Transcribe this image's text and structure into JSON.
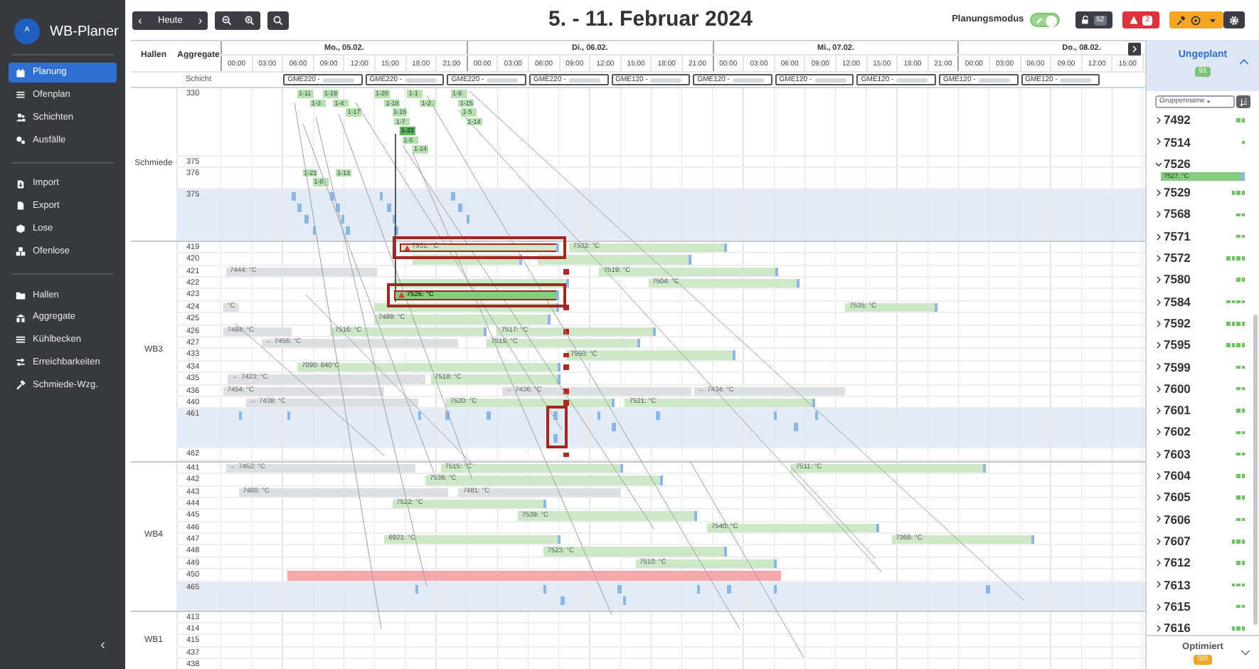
{
  "sidebar": {
    "logo_letter": "A",
    "app_name": "WB-Planer",
    "collapse": "‹",
    "groups": [
      [
        {
          "label": "Planung",
          "selected": true
        },
        {
          "label": "Ofenplan",
          "selected": false
        },
        {
          "label": "Schichten",
          "selected": false
        },
        {
          "label": "Ausfälle",
          "selected": false
        }
      ],
      [
        {
          "label": "Import",
          "selected": false
        },
        {
          "label": "Export",
          "selected": false
        },
        {
          "label": "Lose",
          "selected": false
        },
        {
          "label": "Ofenlose",
          "selected": false
        }
      ],
      [
        {
          "label": "Hallen",
          "selected": false
        },
        {
          "label": "Aggregate",
          "selected": false
        },
        {
          "label": "Kühlbecken",
          "selected": false
        },
        {
          "label": "Erreichbarkeiten",
          "selected": false
        },
        {
          "label": "Schmiede-Wzg.",
          "selected": false
        }
      ]
    ]
  },
  "toolbar": {
    "prev": "‹",
    "today": "Heute",
    "next": "›",
    "title": "5. - 11. Februar 2024",
    "mode_label": "Planungsmodus",
    "mode_on": true,
    "lock_badge": "52",
    "alert_badge": "2"
  },
  "gantt": {
    "columns": [
      "Hallen",
      "Aggregate"
    ],
    "days": [
      {
        "label": "Mo., 05.02.",
        "hours": [
          "00:00",
          "03:00",
          "06:00",
          "09:00",
          "12:00",
          "15:00",
          "18:00",
          "21:00"
        ]
      },
      {
        "label": "Di., 06.02.",
        "hours": [
          "00:00",
          "03:00",
          "06:00",
          "09:00",
          "12:00",
          "15:00",
          "18:00",
          "21:00"
        ]
      },
      {
        "label": "Mi., 07.02.",
        "hours": [
          "00:00",
          "03:00",
          "06:00",
          "09:00",
          "12:00",
          "15:00",
          "18:00",
          "21:00"
        ]
      },
      {
        "label": "Do., 08.02.",
        "hours": [
          "00:00",
          "03:00",
          "06:00",
          "09:00",
          "12:00",
          "15:00"
        ]
      }
    ],
    "shift_row": {
      "label": "Schicht",
      "shifts": [
        "GME220 -",
        "GME220 -",
        "GME220 -",
        "GME220 -",
        "GME120 -",
        "GME120 -",
        "GME120 -",
        "GME120 -",
        "GME120 -",
        "GME120 -"
      ]
    },
    "halls": [
      {
        "name": "Schmiede",
        "rows": [
          {
            "unit": "330",
            "kind": "unit",
            "conflict": false,
            "highlighted": false,
            "cascades": [
              [
                {
                  "label": "1-11",
                  "selected": false
                },
                {
                  "label": "1-3",
                  "selected": false
                }
              ],
              [
                {
                  "label": "1-19",
                  "selected": false
                },
                {
                  "label": "1-4",
                  "selected": false
                },
                {
                  "label": "1-17",
                  "selected": false
                }
              ],
              [
                {
                  "label": "1-20",
                  "selected": false
                },
                {
                  "label": "1-18",
                  "selected": false
                },
                {
                  "label": "1-16",
                  "selected": false
                },
                {
                  "label": "1-7",
                  "selected": false
                },
                {
                  "label": "1-22",
                  "selected": true
                },
                {
                  "label": "1-5",
                  "selected": false
                },
                {
                  "label": "1-24",
                  "selected": false
                }
              ],
              [
                {
                  "label": "1-1",
                  "selected": false
                },
                {
                  "label": "1-2",
                  "selected": false
                }
              ],
              [
                {
                  "label": "1-9",
                  "selected": false
                },
                {
                  "label": "1-15",
                  "selected": false
                },
                {
                  "label": "1-5",
                  "selected": false
                },
                {
                  "label": "1-14",
                  "selected": false
                }
              ]
            ]
          },
          {
            "unit": "375",
            "kind": "unit",
            "conflict": false,
            "highlighted": false
          },
          {
            "unit": "376",
            "kind": "unit",
            "conflict": false,
            "highlighted": false,
            "cascades": [
              [
                {
                  "label": "1-21",
                  "selected": false
                },
                {
                  "label": "1-8",
                  "selected": false
                }
              ],
              [
                {
                  "label": "1-13",
                  "selected": false
                }
              ]
            ]
          },
          {
            "unit": "375",
            "kind": "capacity",
            "conflict": false,
            "highlighted": false
          }
        ]
      },
      {
        "name": "WB3",
        "rows": [
          {
            "unit": "419",
            "kind": "unit",
            "conflict": false,
            "highlighted": false,
            "bars": [
              {
                "kind": "planned",
                "label": "7531: °C",
                "warning": true,
                "highlighted": true
              },
              {
                "kind": "planned",
                "label": "7532: °C",
                "warning": false,
                "highlighted": false
              }
            ]
          },
          {
            "unit": "420",
            "kind": "unit",
            "conflict": false,
            "highlighted": false,
            "bars": [
              {
                "kind": "planned",
                "warning": false,
                "highlighted": false
              },
              {
                "kind": "planned",
                "warning": false,
                "highlighted": false
              }
            ]
          },
          {
            "unit": "421",
            "kind": "unit",
            "conflict": true,
            "highlighted": false,
            "bars": [
              {
                "kind": "external",
                "label": "7444: °C",
                "warning": false,
                "highlighted": false
              },
              {
                "kind": "planned",
                "label": "7519: °C",
                "warning": false,
                "highlighted": false
              }
            ]
          },
          {
            "unit": "422",
            "kind": "unit",
            "conflict": false,
            "highlighted": false,
            "bars": [
              {
                "kind": "planned",
                "warning": false,
                "highlighted": false
              },
              {
                "kind": "planned",
                "label": "7504: °C",
                "warning": false,
                "highlighted": false
              }
            ]
          },
          {
            "unit": "423",
            "kind": "unit",
            "conflict": false,
            "highlighted": false,
            "bars": [
              {
                "kind": "active",
                "label": "7526: °C",
                "warning": true,
                "highlighted": true
              }
            ]
          },
          {
            "unit": "424",
            "kind": "unit",
            "conflict": true,
            "highlighted": false,
            "bars": [
              {
                "kind": "external",
                "label": "°C",
                "warning": false,
                "highlighted": false
              },
              {
                "kind": "planned",
                "warning": false,
                "highlighted": false
              },
              {
                "kind": "planned",
                "label": "7535: °C",
                "warning": false,
                "highlighted": false
              }
            ]
          },
          {
            "unit": "425",
            "kind": "unit",
            "conflict": false,
            "highlighted": false,
            "bars": [
              {
                "kind": "planned",
                "label": "7489: °C",
                "warning": false,
                "highlighted": false
              }
            ]
          },
          {
            "unit": "426",
            "kind": "unit",
            "conflict": true,
            "highlighted": false,
            "bars": [
              {
                "kind": "external",
                "label": "7484: °C",
                "warning": false,
                "highlighted": false
              },
              {
                "kind": "planned",
                "label": "7516: °C",
                "warning": false,
                "highlighted": false
              },
              {
                "kind": "planned",
                "label": "7517: °C",
                "warning": false,
                "highlighted": false
              }
            ]
          },
          {
            "unit": "427",
            "kind": "unit",
            "conflict": false,
            "highlighted": false,
            "bars": [
              {
                "kind": "external",
                "label": "← 7456: °C",
                "warning": false,
                "highlighted": false
              },
              {
                "kind": "planned",
                "label": "7519: °C",
                "warning": false,
                "highlighted": false
              }
            ]
          },
          {
            "unit": "433",
            "kind": "unit",
            "conflict": true,
            "highlighted": false,
            "bars": [
              {
                "kind": "planned",
                "label": "7550: °C",
                "warning": false,
                "highlighted": false
              }
            ]
          },
          {
            "unit": "434",
            "kind": "unit",
            "conflict": true,
            "highlighted": false,
            "bars": [
              {
                "kind": "planned",
                "label": "7090: 840°C",
                "warning": false,
                "highlighted": false
              }
            ]
          },
          {
            "unit": "435",
            "kind": "unit",
            "conflict": false,
            "highlighted": false,
            "bars": [
              {
                "kind": "external",
                "label": "← 7423: °C",
                "warning": false,
                "highlighted": false
              },
              {
                "kind": "planned",
                "label": "7518: °C",
                "warning": false,
                "highlighted": false
              }
            ]
          },
          {
            "unit": "436",
            "kind": "unit",
            "conflict": true,
            "highlighted": false,
            "bars": [
              {
                "kind": "external",
                "label": "7454: °C",
                "warning": false,
                "highlighted": false
              },
              {
                "kind": "external",
                "label": "← 7436: °C",
                "warning": false,
                "highlighted": false
              },
              {
                "kind": "external",
                "label": "← 7434: °C",
                "warning": false,
                "highlighted": false
              }
            ]
          },
          {
            "unit": "440",
            "kind": "unit",
            "conflict": true,
            "highlighted": false,
            "bars": [
              {
                "kind": "external",
                "label": "← 7438: °C",
                "warning": false,
                "highlighted": false
              },
              {
                "kind": "planned",
                "label": "7520: °C",
                "warning": false,
                "highlighted": false
              },
              {
                "kind": "planned",
                "label": "7521: °C",
                "warning": false,
                "highlighted": false
              }
            ]
          },
          {
            "unit": "461",
            "kind": "capacity",
            "conflict": false,
            "highlighted": true
          },
          {
            "unit": "462",
            "kind": "unit",
            "conflict": true,
            "highlighted": false
          }
        ]
      },
      {
        "name": "WB4",
        "rows": [
          {
            "unit": "441",
            "kind": "unit",
            "conflict": false,
            "highlighted": false,
            "bars": [
              {
                "kind": "external",
                "label": "← 7452: °C",
                "warning": false,
                "highlighted": false
              },
              {
                "kind": "planned",
                "label": "7515: °C",
                "warning": false,
                "highlighted": false
              },
              {
                "kind": "planned",
                "label": "7511: °C",
                "warning": false,
                "highlighted": false
              }
            ]
          },
          {
            "unit": "442",
            "kind": "unit",
            "conflict": false,
            "highlighted": false,
            "bars": [
              {
                "kind": "planned",
                "label": "7536: °C",
                "warning": false,
                "highlighted": false
              }
            ]
          },
          {
            "unit": "443",
            "kind": "unit",
            "conflict": false,
            "highlighted": false,
            "bars": [
              {
                "kind": "external",
                "label": "7480: °C",
                "warning": false,
                "highlighted": false
              },
              {
                "kind": "external",
                "label": "7481: °C",
                "warning": false,
                "highlighted": false
              }
            ]
          },
          {
            "unit": "444",
            "kind": "unit",
            "conflict": false,
            "highlighted": false,
            "bars": [
              {
                "kind": "planned",
                "label": "7522: °C",
                "warning": false,
                "highlighted": false
              }
            ]
          },
          {
            "unit": "445",
            "kind": "unit",
            "conflict": false,
            "highlighted": false,
            "bars": [
              {
                "kind": "planned",
                "label": "7539: °C",
                "warning": false,
                "highlighted": false
              }
            ]
          },
          {
            "unit": "446",
            "kind": "unit",
            "conflict": false,
            "highlighted": false,
            "bars": [
              {
                "kind": "planned",
                "label": "7540: °C",
                "warning": false,
                "highlighted": false
              }
            ]
          },
          {
            "unit": "447",
            "kind": "unit",
            "conflict": false,
            "highlighted": false,
            "bars": [
              {
                "kind": "planned",
                "label": "6921: °C",
                "warning": false,
                "highlighted": false
              },
              {
                "kind": "planned",
                "label": "7368: °C",
                "warning": false,
                "highlighted": false
              }
            ]
          },
          {
            "unit": "448",
            "kind": "unit",
            "conflict": false,
            "highlighted": false,
            "bars": [
              {
                "kind": "planned",
                "label": "7523: °C",
                "warning": false,
                "highlighted": false
              }
            ]
          },
          {
            "unit": "449",
            "kind": "unit",
            "conflict": false,
            "highlighted": false,
            "bars": [
              {
                "kind": "planned",
                "label": "7510: °C",
                "warning": false,
                "highlighted": false
              }
            ]
          },
          {
            "unit": "450",
            "kind": "unit",
            "conflict": false,
            "highlighted": false,
            "bars": [
              {
                "kind": "blocked",
                "warning": false,
                "highlighted": false
              }
            ]
          },
          {
            "unit": "465",
            "kind": "capacity",
            "conflict": false,
            "highlighted": false
          }
        ]
      },
      {
        "name": "WB1",
        "rows": [
          {
            "unit": "413",
            "kind": "unit",
            "conflict": false,
            "highlighted": false
          },
          {
            "unit": "414",
            "kind": "unit",
            "conflict": false,
            "highlighted": false
          },
          {
            "unit": "415",
            "kind": "unit",
            "conflict": false,
            "highlighted": false
          },
          {
            "unit": "437",
            "kind": "unit",
            "conflict": false,
            "highlighted": false
          },
          {
            "unit": "438",
            "kind": "unit",
            "conflict": false,
            "highlighted": false
          }
        ]
      }
    ]
  },
  "unplanned": {
    "title": "Ungeplant",
    "count": "91",
    "filter": "Gruppenname",
    "items": [
      {
        "label": "7492",
        "expanded": false,
        "parts": [
          {
            "kind": "open"
          },
          {
            "kind": "open"
          }
        ]
      },
      {
        "label": "7514",
        "expanded": false,
        "parts": [
          {
            "kind": "open"
          }
        ]
      },
      {
        "label": "7526",
        "expanded": true,
        "children": [
          {
            "label": "7527: °C"
          }
        ]
      },
      {
        "label": "7529",
        "expanded": false,
        "parts": [
          {
            "kind": "open"
          },
          {
            "kind": "open"
          },
          {
            "kind": "open"
          }
        ]
      },
      {
        "label": "7568",
        "expanded": false,
        "parts": [
          {
            "kind": "open"
          },
          {
            "kind": "open"
          }
        ]
      },
      {
        "label": "7571",
        "expanded": false,
        "parts": [
          {
            "kind": "open"
          },
          {
            "kind": "open"
          }
        ]
      },
      {
        "label": "7572",
        "expanded": false,
        "parts": [
          {
            "kind": "open"
          },
          {
            "kind": "open"
          },
          {
            "kind": "open"
          },
          {
            "kind": "open"
          }
        ]
      },
      {
        "label": "7580",
        "expanded": false,
        "parts": [
          {
            "kind": "open"
          },
          {
            "kind": "open"
          }
        ]
      },
      {
        "label": "7584",
        "expanded": false,
        "parts": [
          {
            "kind": "open"
          },
          {
            "kind": "open"
          },
          {
            "kind": "open"
          },
          {
            "kind": "open"
          }
        ]
      },
      {
        "label": "7592",
        "expanded": false,
        "parts": [
          {
            "kind": "open"
          },
          {
            "kind": "open"
          },
          {
            "kind": "open"
          },
          {
            "kind": "open"
          }
        ]
      },
      {
        "label": "7595",
        "expanded": false,
        "parts": [
          {
            "kind": "open"
          },
          {
            "kind": "open"
          },
          {
            "kind": "open"
          },
          {
            "kind": "open"
          }
        ]
      },
      {
        "label": "7599",
        "expanded": false,
        "parts": [
          {
            "kind": "open"
          },
          {
            "kind": "open"
          }
        ]
      },
      {
        "label": "7600",
        "expanded": false,
        "parts": [
          {
            "kind": "open"
          },
          {
            "kind": "open"
          }
        ]
      },
      {
        "label": "7601",
        "expanded": false,
        "parts": [
          {
            "kind": "open"
          },
          {
            "kind": "open"
          }
        ]
      },
      {
        "label": "7602",
        "expanded": false,
        "parts": [
          {
            "kind": "open"
          },
          {
            "kind": "open"
          }
        ]
      },
      {
        "label": "7603",
        "expanded": false,
        "parts": [
          {
            "kind": "open"
          },
          {
            "kind": "open"
          }
        ]
      },
      {
        "label": "7604",
        "expanded": false,
        "parts": [
          {
            "kind": "open"
          },
          {
            "kind": "open"
          }
        ]
      },
      {
        "label": "7605",
        "expanded": false,
        "parts": [
          {
            "kind": "open"
          },
          {
            "kind": "open"
          }
        ]
      },
      {
        "label": "7606",
        "expanded": false,
        "parts": [
          {
            "kind": "open"
          },
          {
            "kind": "open"
          }
        ]
      },
      {
        "label": "7607",
        "expanded": false,
        "parts": [
          {
            "kind": "open"
          },
          {
            "kind": "open"
          },
          {
            "kind": "open"
          }
        ]
      },
      {
        "label": "7612",
        "expanded": false,
        "parts": [
          {
            "kind": "open"
          },
          {
            "kind": "open"
          }
        ]
      },
      {
        "label": "7613",
        "expanded": false,
        "parts": [
          {
            "kind": "open"
          },
          {
            "kind": "open"
          },
          {
            "kind": "open"
          }
        ]
      },
      {
        "label": "7615",
        "expanded": false,
        "parts": [
          {
            "kind": "open"
          },
          {
            "kind": "open"
          }
        ]
      },
      {
        "label": "7616",
        "expanded": false,
        "parts": [
          {
            "kind": "open"
          },
          {
            "kind": "open"
          },
          {
            "kind": "open"
          }
        ]
      }
    ]
  },
  "optimized": {
    "title": "Optimiert",
    "count": "0/0"
  }
}
